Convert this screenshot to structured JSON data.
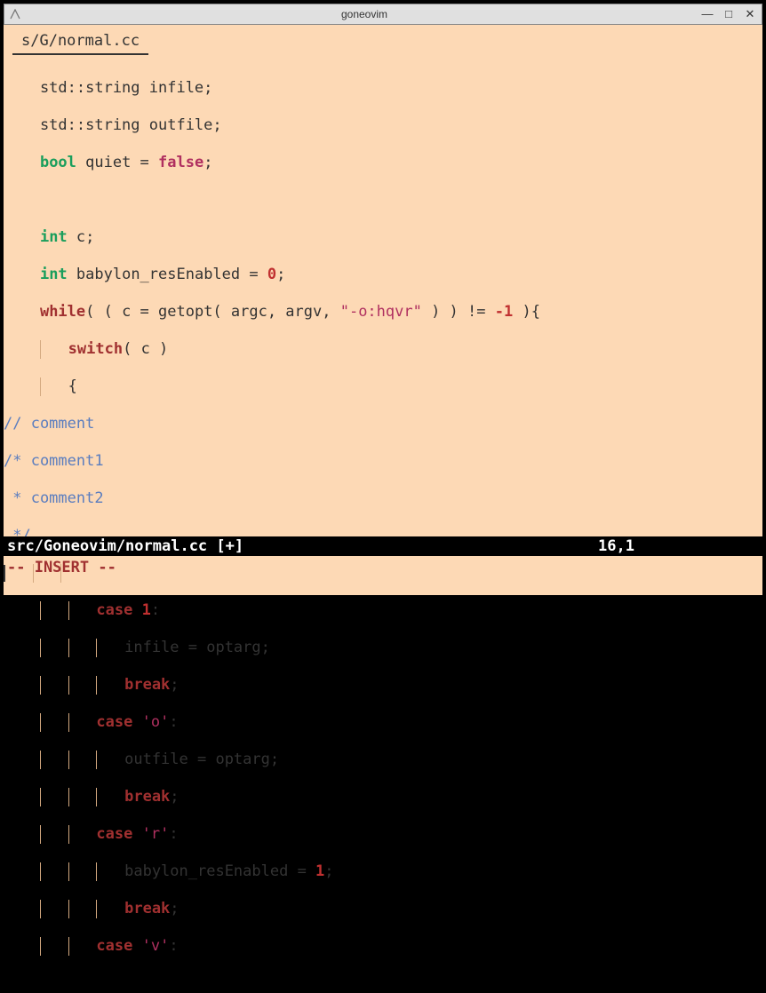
{
  "window": {
    "title": "goneovim"
  },
  "tab": {
    "label": " s/G/normal.cc "
  },
  "code": {
    "l1_a": "    std::string infile;",
    "l2_a": "    std::string outfile;",
    "l3_bool": "bool",
    "l3_mid": " quiet = ",
    "l3_false": "false",
    "l3_semi": ";",
    "l5_int": "int",
    "l5_rest": " c;",
    "l6_int": "int",
    "l6_rest": " babylon_resEnabled = ",
    "l6_zero": "0",
    "l6_semi": ";",
    "l7_while": "while",
    "l7_a": "( ( c = getopt( argc, argv, ",
    "l7_str": "\"-o:hqvr\"",
    "l7_b": " ) ) != ",
    "l7_neg1": "-1",
    "l7_c": " ){",
    "l8_switch": "switch",
    "l8_rest": "( c )",
    "l9_brace": "{",
    "l10": "// comment",
    "l11": "/* comment1",
    "l12": " * comment2",
    "l13": " */",
    "l15_case": "case",
    "l15_n": "1",
    "l15_colon": ":",
    "l16": "infile = optarg;",
    "l17_break": "break",
    "l17_semi": ";",
    "l18_case": "case",
    "l18_chr": "'o'",
    "l18_colon": ":",
    "l19": "outfile = optarg;",
    "l20_break": "break",
    "l20_semi": ";",
    "l21_case": "case",
    "l21_chr": "'r'",
    "l21_colon": ":",
    "l22": "babylon_resEnabled = ",
    "l22_one": "1",
    "l22_semi": ";",
    "l23_break": "break",
    "l23_semi": ";",
    "l24_case": "case",
    "l24_chr": "'v'",
    "l24_colon": ":"
  },
  "status": {
    "file": "src/Goneovim/normal.cc [+]",
    "position": "16,1"
  },
  "mode": {
    "text": "-- INSERT --"
  }
}
